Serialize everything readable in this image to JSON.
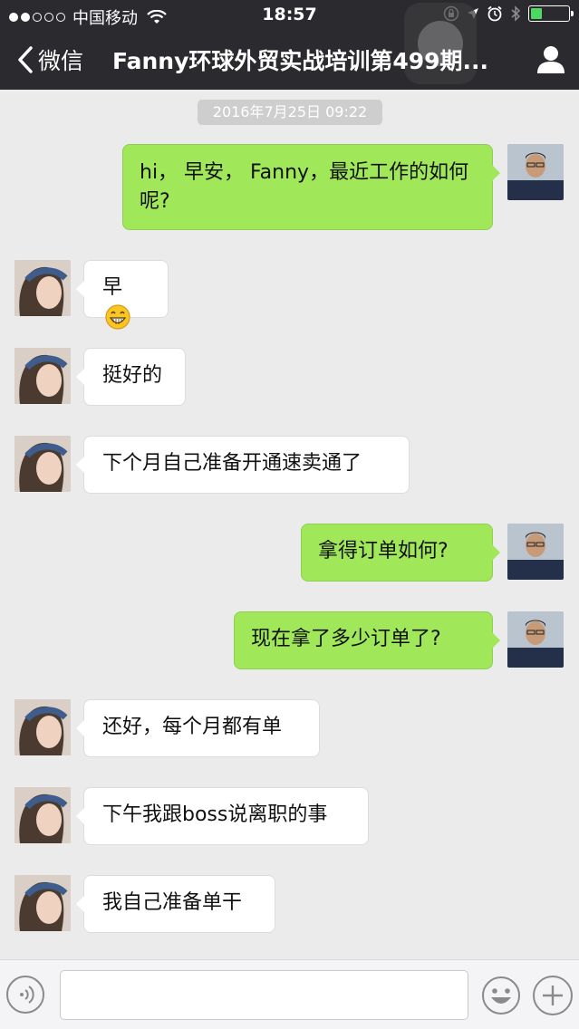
{
  "status_bar": {
    "carrier": "中国移动",
    "time": "18:57"
  },
  "nav": {
    "back_label": "微信",
    "title": "Fanny环球外贸实战培训第499期..."
  },
  "chat": {
    "timestamp": "2016年7月25日 09:22",
    "messages": [
      {
        "from": "me",
        "text": "hi， 早安， Fanny，最近工作的如何呢?"
      },
      {
        "from": "fanny",
        "text": "早"
      },
      {
        "from": "fanny",
        "text": "挺好的"
      },
      {
        "from": "fanny",
        "text": "下个月自己准备开通速卖通了"
      },
      {
        "from": "me",
        "text": "拿得订单如何?"
      },
      {
        "from": "me",
        "text": "现在拿了多少订单了?"
      },
      {
        "from": "fanny",
        "text": "还好，每个月都有单"
      },
      {
        "from": "fanny",
        "text": "下午我跟boss说离职的事"
      },
      {
        "from": "fanny",
        "text": "我自己准备单干"
      }
    ]
  },
  "input_bar": {
    "placeholder": ""
  },
  "colors": {
    "nav_bg": "#2b2b2f",
    "chat_bg": "#ebebeb",
    "outgoing_bubble": "#a0e75a",
    "incoming_bubble": "#ffffff",
    "battery_fill": "#4cd964"
  },
  "icons": [
    "back-chevron-icon",
    "profile-icon",
    "wifi-icon",
    "lock-rotation-icon",
    "location-icon",
    "alarm-icon",
    "bluetooth-icon",
    "battery-icon",
    "grin-emoji-icon",
    "voice-icon",
    "emoji-icon",
    "plus-icon"
  ]
}
